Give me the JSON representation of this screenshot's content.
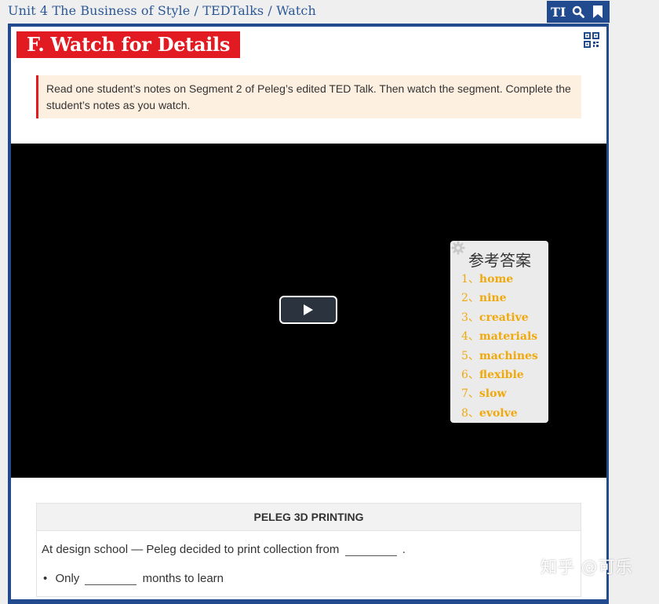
{
  "breadcrumb": {
    "unit": "Unit 4 The Business of Style",
    "sep1": " / ",
    "section": "TEDTalks",
    "sep2": " / ",
    "page": "Watch"
  },
  "toolbar": {
    "text_size_label": "TI",
    "icons": [
      "text-size-icon",
      "search-icon",
      "bookmark-icon"
    ]
  },
  "activity": {
    "title": "F. Watch for Details",
    "instructions": "Read one student’s notes on Segment 2 of Peleg’s edited TED Talk. Then watch the segment. Complete the student’s notes as you watch."
  },
  "answer_key": {
    "title": "参考答案",
    "items": [
      {
        "num": "1、",
        "text": "home"
      },
      {
        "num": "2、",
        "text": "nine"
      },
      {
        "num": "3、",
        "text": "creative"
      },
      {
        "num": "4、",
        "text": "materials"
      },
      {
        "num": "5、",
        "text": "machines"
      },
      {
        "num": "6、",
        "text": "flexible"
      },
      {
        "num": "7、",
        "text": "slow"
      },
      {
        "num": "8、",
        "text": "evolve"
      }
    ]
  },
  "notes": {
    "heading": "PELEG 3D PRINTING",
    "line1_prefix": "At design school — Peleg decided to print collection from",
    "line1_suffix": ".",
    "bullet1_prefix": "Only",
    "bullet1_suffix": "months to learn"
  },
  "watermark": "知乎 @可乐",
  "colors": {
    "brand_blue": "#224b8f",
    "title_red": "#e21b23",
    "answer_orange": "#f0a90c",
    "instruction_bg": "#fdf0e0"
  }
}
